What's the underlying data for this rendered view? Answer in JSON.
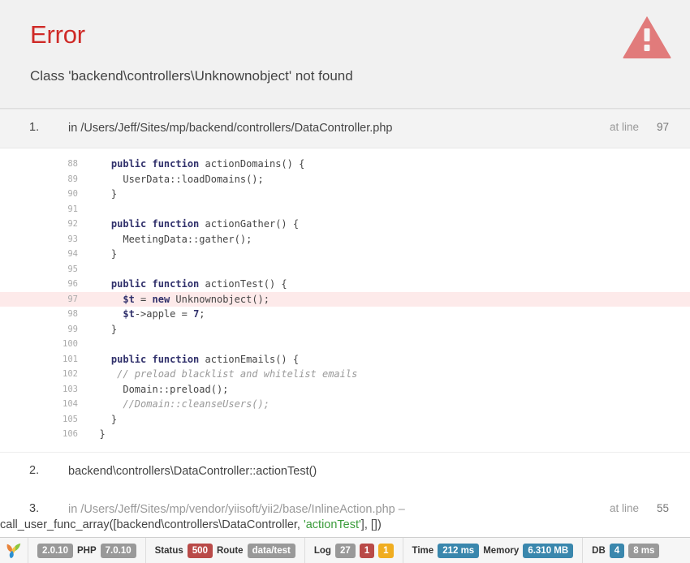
{
  "header": {
    "title": "Error",
    "message": "Class 'backend\\controllers\\Unknownobject' not found",
    "icon": "warning-triangle-icon",
    "accent_color": "#cf2a27",
    "background": "#f1f1f1"
  },
  "call_stack": [
    {
      "num": "1.",
      "prefix": "in ",
      "file": "/Users/Jeff/Sites/mp/backend/controllers/DataController.php",
      "suffix": "",
      "at_line_label": "at line",
      "line_number": "97",
      "shaded": true
    },
    {
      "num": "2.",
      "prefix": "",
      "file": "backend\\controllers\\DataController::actionTest()",
      "suffix": "",
      "at_line_label": "",
      "line_number": "",
      "shaded": false
    },
    {
      "num": "3.",
      "prefix": "in ",
      "file": "/Users/Jeff/Sites/mp/vendor/yiisoft/yii2/base/InlineAction.php",
      "dash": " – ",
      "call_pre": "call_user_func_array([backend\\controllers\\DataController, ",
      "call_arg": "'actionTest'",
      "call_post": "], [])",
      "at_line_label": "at line",
      "line_number": "55",
      "shaded": false
    }
  ],
  "code": {
    "error_line": 97,
    "lines": [
      {
        "no": "88",
        "segments": [
          {
            "t": "    ",
            "c": ""
          },
          {
            "t": "public function ",
            "c": "kw"
          },
          {
            "t": "actionDomains() {",
            "c": ""
          }
        ]
      },
      {
        "no": "89",
        "segments": [
          {
            "t": "      UserData::loadDomains();",
            "c": ""
          }
        ]
      },
      {
        "no": "90",
        "segments": [
          {
            "t": "    }",
            "c": ""
          }
        ]
      },
      {
        "no": "91",
        "segments": [
          {
            "t": "",
            "c": ""
          }
        ]
      },
      {
        "no": "92",
        "segments": [
          {
            "t": "    ",
            "c": ""
          },
          {
            "t": "public function ",
            "c": "kw"
          },
          {
            "t": "actionGather() {",
            "c": ""
          }
        ]
      },
      {
        "no": "93",
        "segments": [
          {
            "t": "      MeetingData::gather();",
            "c": ""
          }
        ]
      },
      {
        "no": "94",
        "segments": [
          {
            "t": "    }",
            "c": ""
          }
        ]
      },
      {
        "no": "95",
        "segments": [
          {
            "t": "",
            "c": ""
          }
        ]
      },
      {
        "no": "96",
        "segments": [
          {
            "t": "    ",
            "c": ""
          },
          {
            "t": "public function ",
            "c": "kw"
          },
          {
            "t": "actionTest() {",
            "c": ""
          }
        ]
      },
      {
        "no": "97",
        "segments": [
          {
            "t": "      ",
            "c": ""
          },
          {
            "t": "$t",
            "c": "kw"
          },
          {
            "t": " = ",
            "c": ""
          },
          {
            "t": "new",
            "c": "kw"
          },
          {
            "t": " Unknownobject();",
            "c": ""
          }
        ]
      },
      {
        "no": "98",
        "segments": [
          {
            "t": "      ",
            "c": ""
          },
          {
            "t": "$t",
            "c": "kw"
          },
          {
            "t": "->apple = ",
            "c": ""
          },
          {
            "t": "7",
            "c": "kw"
          },
          {
            "t": ";",
            "c": ""
          }
        ]
      },
      {
        "no": "99",
        "segments": [
          {
            "t": "    }",
            "c": ""
          }
        ]
      },
      {
        "no": "100",
        "segments": [
          {
            "t": "",
            "c": ""
          }
        ]
      },
      {
        "no": "101",
        "segments": [
          {
            "t": "    ",
            "c": ""
          },
          {
            "t": "public function ",
            "c": "kw"
          },
          {
            "t": "actionEmails() {",
            "c": ""
          }
        ]
      },
      {
        "no": "102",
        "segments": [
          {
            "t": "     ",
            "c": ""
          },
          {
            "t": "// preload blacklist and whitelist emails",
            "c": "cm"
          }
        ]
      },
      {
        "no": "103",
        "segments": [
          {
            "t": "      Domain::preload();",
            "c": ""
          }
        ]
      },
      {
        "no": "104",
        "segments": [
          {
            "t": "      ",
            "c": ""
          },
          {
            "t": "//Domain::cleanseUsers();",
            "c": "cm"
          }
        ]
      },
      {
        "no": "105",
        "segments": [
          {
            "t": "    }",
            "c": ""
          }
        ]
      },
      {
        "no": "106",
        "segments": [
          {
            "t": "  }",
            "c": ""
          }
        ]
      }
    ]
  },
  "debug_toolbar": {
    "logo": "yii-logo-icon",
    "groups": [
      {
        "name": "version",
        "items": [
          {
            "kind": "badge",
            "text": "2.0.10",
            "color": "gray",
            "name": "yii-version-badge"
          },
          {
            "kind": "label",
            "text": "PHP",
            "name": "php-label"
          },
          {
            "kind": "badge",
            "text": "7.0.10",
            "color": "gray",
            "name": "php-version-badge"
          }
        ]
      },
      {
        "name": "request",
        "items": [
          {
            "kind": "label",
            "text": "Status",
            "name": "status-label"
          },
          {
            "kind": "badge",
            "text": "500",
            "color": "red",
            "name": "status-code-badge"
          },
          {
            "kind": "label",
            "text": "Route",
            "name": "route-label"
          },
          {
            "kind": "badge",
            "text": "data/test",
            "color": "gray",
            "name": "route-badge"
          }
        ]
      },
      {
        "name": "log",
        "items": [
          {
            "kind": "label",
            "text": "Log",
            "name": "log-label"
          },
          {
            "kind": "badge",
            "text": "27",
            "color": "gray",
            "name": "log-total-badge"
          },
          {
            "kind": "badge",
            "text": "1",
            "color": "red",
            "name": "log-error-badge"
          },
          {
            "kind": "badge",
            "text": "1",
            "color": "orange",
            "name": "log-warning-badge"
          }
        ]
      },
      {
        "name": "performance",
        "items": [
          {
            "kind": "label",
            "text": "Time",
            "name": "time-label"
          },
          {
            "kind": "badge",
            "text": "212 ms",
            "color": "blue",
            "name": "time-badge"
          },
          {
            "kind": "label",
            "text": "Memory",
            "name": "memory-label"
          },
          {
            "kind": "badge",
            "text": "6.310 MB",
            "color": "blue",
            "name": "memory-badge"
          }
        ]
      },
      {
        "name": "database",
        "items": [
          {
            "kind": "label",
            "text": "DB",
            "name": "db-label"
          },
          {
            "kind": "badge",
            "text": "4",
            "color": "blue",
            "name": "db-count-badge"
          },
          {
            "kind": "badge",
            "text": "8 ms",
            "color": "gray",
            "name": "db-time-badge"
          }
        ]
      }
    ]
  }
}
